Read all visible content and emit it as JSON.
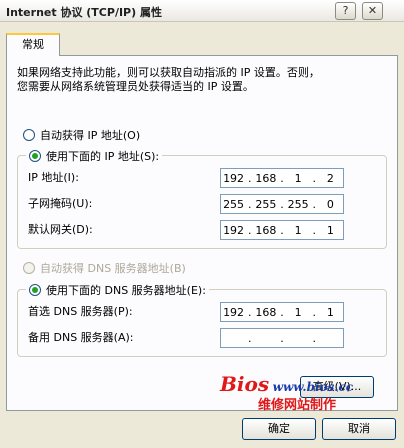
{
  "window": {
    "title": "Internet 协议 (TCP/IP) 属性",
    "help_btn": "?",
    "close_btn": "✕"
  },
  "tabs": [
    {
      "label": "常规"
    }
  ],
  "description": "如果网络支持此功能，则可以获取自动指派的 IP 设置。否则，\n您需要从网络系统管理员处获得适当的 IP 设置。",
  "ip": {
    "auto_label": "自动获得 IP 地址(O)",
    "manual_label": "使用下面的 IP 地址(S):",
    "fields": [
      {
        "label": "IP 地址(I):",
        "octets": [
          "192",
          "168",
          "1",
          "2"
        ]
      },
      {
        "label": "子网掩码(U):",
        "octets": [
          "255",
          "255",
          "255",
          "0"
        ]
      },
      {
        "label": "默认网关(D):",
        "octets": [
          "192",
          "168",
          "1",
          "1"
        ]
      }
    ]
  },
  "dns": {
    "auto_label": "自动获得 DNS 服务器地址(B)",
    "manual_label": "使用下面的 DNS 服务器地址(E):",
    "fields": [
      {
        "label": "首选 DNS 服务器(P):",
        "octets": [
          "192",
          "168",
          "1",
          "1"
        ]
      },
      {
        "label": "备用 DNS 服务器(A):",
        "octets": [
          "",
          "",
          "",
          ""
        ]
      }
    ]
  },
  "advanced_button": "高级(V)...",
  "watermark": {
    "brand": "Bios",
    "url": "www.bios.cc",
    "slogan": "维修网站制作"
  },
  "footer": {
    "ok": "确定",
    "cancel": "取消"
  }
}
